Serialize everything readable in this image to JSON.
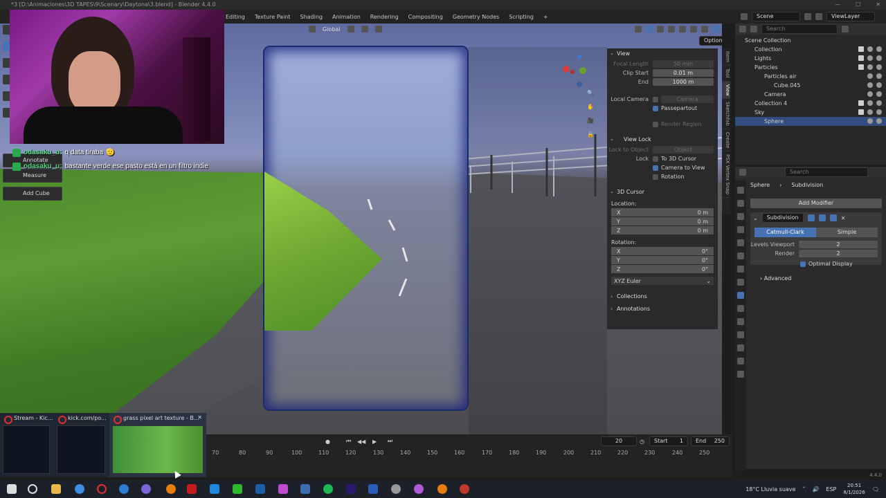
{
  "window": {
    "title": "*3 [D:\\Animaciones\\3D TAPES\\9\\Scenary\\Daytona\\3.blend] - Blender 4.4.0"
  },
  "menubar": {
    "workspaces": [
      "Editing",
      "Texture Paint",
      "Shading",
      "Animation",
      "Rendering",
      "Compositing",
      "Geometry Nodes",
      "Scripting",
      "+"
    ],
    "scene": "Scene",
    "view_layer": "ViewLayer"
  },
  "viewport": {
    "orientation": "Global",
    "options_label": "Options"
  },
  "toolbar": {
    "annotate": "Annotate",
    "measure": "Measure",
    "add_cube": "Add Cube"
  },
  "chat": {
    "messages": [
      {
        "user": "odasaku_u:",
        "text": "q data tiraba",
        "emoji": "🫡"
      },
      {
        "user": "odasaku_u:",
        "text": "bastante verde ese pasto está en un filtro indie",
        "emoji": ""
      }
    ]
  },
  "npanel": {
    "view_header": "View",
    "focal_length_label": "Focal Length",
    "focal_length_value": "50 mm",
    "clip_start_label": "Clip Start",
    "clip_start_value": "0.01 m",
    "end_label": "End",
    "end_value": "1000 m",
    "local_camera_label": "Local Camera",
    "local_camera_value": "Camera",
    "passepartout": "Passepartout",
    "render_region": "Render Region",
    "view_lock_header": "View Lock",
    "lock_to_object_label": "Lock to Object",
    "lock_to_object_value": "Object",
    "lock_label": "Lock",
    "to_3d_cursor": "To 3D Cursor",
    "camera_to_view": "Camera to View",
    "rotation_lock": "Rotation",
    "cursor_header": "3D Cursor",
    "location_label": "Location:",
    "loc": [
      {
        "axis": "X",
        "value": "0 m"
      },
      {
        "axis": "Y",
        "value": "0 m"
      },
      {
        "axis": "Z",
        "value": "0 m"
      }
    ],
    "rotation_label": "Rotation:",
    "rot": [
      {
        "axis": "X",
        "value": "0°"
      },
      {
        "axis": "Y",
        "value": "0°"
      },
      {
        "axis": "Z",
        "value": "0°"
      }
    ],
    "rotation_mode": "XYZ Euler",
    "collections_header": "Collections",
    "annotations_header": "Annotations"
  },
  "sidetabs": [
    "Item",
    "Tool",
    "View",
    "Sketchfab",
    "Create",
    "PSX Vertex Snap"
  ],
  "outliner": {
    "search_placeholder": "Search",
    "rows": [
      {
        "label": "Scene Collection",
        "indent": 0
      },
      {
        "label": "Collection",
        "indent": 1
      },
      {
        "label": "Lights",
        "indent": 1
      },
      {
        "label": "Particles",
        "indent": 1
      },
      {
        "label": "Particles air",
        "indent": 2
      },
      {
        "label": "Cube.045",
        "indent": 3
      },
      {
        "label": "Camera",
        "indent": 2
      },
      {
        "label": "Collection 4",
        "indent": 1
      },
      {
        "label": "Sky",
        "indent": 1
      },
      {
        "label": "Sphere",
        "indent": 2
      }
    ]
  },
  "properties": {
    "search_placeholder": "Search",
    "breadcrumb_object": "Sphere",
    "breadcrumb_modifier": "Subdivision",
    "add_modifier": "Add Modifier",
    "modifier_name": "Subdivision",
    "catmull_clark": "Catmull-Clark",
    "simple": "Simple",
    "levels_viewport_label": "Levels Viewport",
    "levels_viewport_value": "2",
    "render_label": "Render",
    "render_value": "2",
    "optimal_display": "Optimal Display",
    "advanced": "Advanced"
  },
  "timeline": {
    "current_frame": "20",
    "start_label": "Start",
    "start_value": "1",
    "end_label": "End",
    "end_value": "250",
    "ticks": [
      "70",
      "80",
      "90",
      "100",
      "110",
      "120",
      "130",
      "140",
      "150",
      "160",
      "170",
      "180",
      "190",
      "200",
      "210",
      "220",
      "230",
      "240",
      "250"
    ],
    "version": "4.4.0"
  },
  "thumbnails": [
    {
      "title": "Stream - Kic..."
    },
    {
      "title": "kick.com/po..."
    },
    {
      "title": "grass pixel art texture - B..."
    }
  ],
  "taskbar": {
    "weather": "18°C  Lluvia suave",
    "lang": "ESP",
    "time": "20:51",
    "date": "8/1/2026"
  }
}
